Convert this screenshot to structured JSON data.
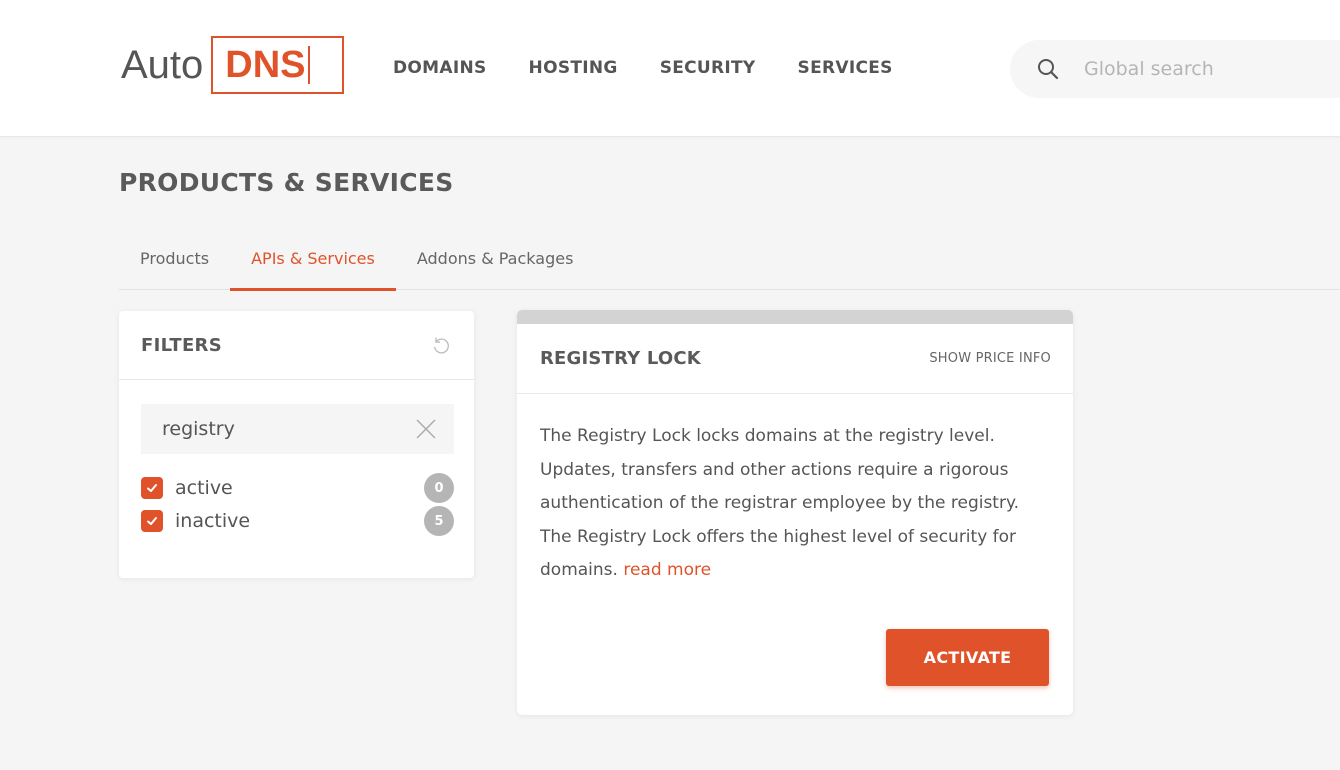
{
  "header": {
    "logo": {
      "part1": "Auto",
      "part2": "DNS"
    },
    "nav": [
      {
        "label": "DOMAINS"
      },
      {
        "label": "HOSTING"
      },
      {
        "label": "SECURITY"
      },
      {
        "label": "SERVICES"
      }
    ],
    "search": {
      "placeholder": "Global search",
      "value": ""
    }
  },
  "page": {
    "title": "PRODUCTS & SERVICES",
    "tabs": [
      {
        "label": "Products",
        "active": false
      },
      {
        "label": "APIs & Services",
        "active": true
      },
      {
        "label": "Addons & Packages",
        "active": false
      }
    ]
  },
  "filters": {
    "title": "FILTERS",
    "search_value": "registry",
    "options": [
      {
        "label": "active",
        "checked": true,
        "count": "0"
      },
      {
        "label": "inactive",
        "checked": true,
        "count": "5"
      }
    ]
  },
  "product_card": {
    "title": "REGISTRY LOCK",
    "price_link": "SHOW PRICE INFO",
    "description": "The Registry Lock locks domains at the registry level. Updates, transfers and other actions require a rigorous authentication of the registrar employee by the registry. The Registry Lock offers the highest level of security for domains.",
    "read_more": "read more",
    "button": "ACTIVATE"
  },
  "colors": {
    "accent": "#e0532a",
    "badge": "#b5b5b5",
    "background": "#f5f5f5"
  }
}
